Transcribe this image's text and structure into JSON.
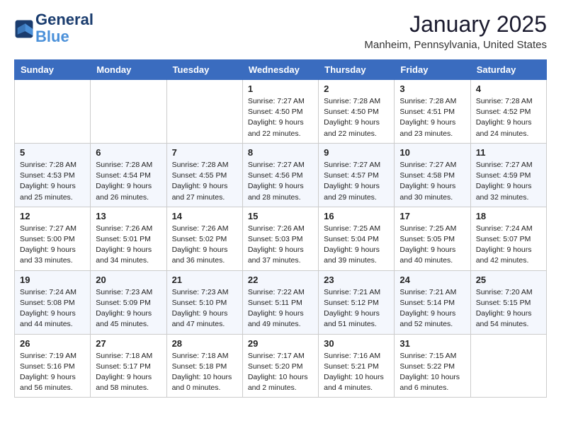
{
  "logo": {
    "line1": "General",
    "line2": "Blue"
  },
  "header": {
    "month": "January 2025",
    "location": "Manheim, Pennsylvania, United States"
  },
  "weekdays": [
    "Sunday",
    "Monday",
    "Tuesday",
    "Wednesday",
    "Thursday",
    "Friday",
    "Saturday"
  ],
  "weeks": [
    [
      {
        "day": "",
        "sunrise": "",
        "sunset": "",
        "daylight": ""
      },
      {
        "day": "",
        "sunrise": "",
        "sunset": "",
        "daylight": ""
      },
      {
        "day": "",
        "sunrise": "",
        "sunset": "",
        "daylight": ""
      },
      {
        "day": "1",
        "sunrise": "Sunrise: 7:27 AM",
        "sunset": "Sunset: 4:50 PM",
        "daylight": "Daylight: 9 hours and 22 minutes."
      },
      {
        "day": "2",
        "sunrise": "Sunrise: 7:28 AM",
        "sunset": "Sunset: 4:50 PM",
        "daylight": "Daylight: 9 hours and 22 minutes."
      },
      {
        "day": "3",
        "sunrise": "Sunrise: 7:28 AM",
        "sunset": "Sunset: 4:51 PM",
        "daylight": "Daylight: 9 hours and 23 minutes."
      },
      {
        "day": "4",
        "sunrise": "Sunrise: 7:28 AM",
        "sunset": "Sunset: 4:52 PM",
        "daylight": "Daylight: 9 hours and 24 minutes."
      }
    ],
    [
      {
        "day": "5",
        "sunrise": "Sunrise: 7:28 AM",
        "sunset": "Sunset: 4:53 PM",
        "daylight": "Daylight: 9 hours and 25 minutes."
      },
      {
        "day": "6",
        "sunrise": "Sunrise: 7:28 AM",
        "sunset": "Sunset: 4:54 PM",
        "daylight": "Daylight: 9 hours and 26 minutes."
      },
      {
        "day": "7",
        "sunrise": "Sunrise: 7:28 AM",
        "sunset": "Sunset: 4:55 PM",
        "daylight": "Daylight: 9 hours and 27 minutes."
      },
      {
        "day": "8",
        "sunrise": "Sunrise: 7:27 AM",
        "sunset": "Sunset: 4:56 PM",
        "daylight": "Daylight: 9 hours and 28 minutes."
      },
      {
        "day": "9",
        "sunrise": "Sunrise: 7:27 AM",
        "sunset": "Sunset: 4:57 PM",
        "daylight": "Daylight: 9 hours and 29 minutes."
      },
      {
        "day": "10",
        "sunrise": "Sunrise: 7:27 AM",
        "sunset": "Sunset: 4:58 PM",
        "daylight": "Daylight: 9 hours and 30 minutes."
      },
      {
        "day": "11",
        "sunrise": "Sunrise: 7:27 AM",
        "sunset": "Sunset: 4:59 PM",
        "daylight": "Daylight: 9 hours and 32 minutes."
      }
    ],
    [
      {
        "day": "12",
        "sunrise": "Sunrise: 7:27 AM",
        "sunset": "Sunset: 5:00 PM",
        "daylight": "Daylight: 9 hours and 33 minutes."
      },
      {
        "day": "13",
        "sunrise": "Sunrise: 7:26 AM",
        "sunset": "Sunset: 5:01 PM",
        "daylight": "Daylight: 9 hours and 34 minutes."
      },
      {
        "day": "14",
        "sunrise": "Sunrise: 7:26 AM",
        "sunset": "Sunset: 5:02 PM",
        "daylight": "Daylight: 9 hours and 36 minutes."
      },
      {
        "day": "15",
        "sunrise": "Sunrise: 7:26 AM",
        "sunset": "Sunset: 5:03 PM",
        "daylight": "Daylight: 9 hours and 37 minutes."
      },
      {
        "day": "16",
        "sunrise": "Sunrise: 7:25 AM",
        "sunset": "Sunset: 5:04 PM",
        "daylight": "Daylight: 9 hours and 39 minutes."
      },
      {
        "day": "17",
        "sunrise": "Sunrise: 7:25 AM",
        "sunset": "Sunset: 5:05 PM",
        "daylight": "Daylight: 9 hours and 40 minutes."
      },
      {
        "day": "18",
        "sunrise": "Sunrise: 7:24 AM",
        "sunset": "Sunset: 5:07 PM",
        "daylight": "Daylight: 9 hours and 42 minutes."
      }
    ],
    [
      {
        "day": "19",
        "sunrise": "Sunrise: 7:24 AM",
        "sunset": "Sunset: 5:08 PM",
        "daylight": "Daylight: 9 hours and 44 minutes."
      },
      {
        "day": "20",
        "sunrise": "Sunrise: 7:23 AM",
        "sunset": "Sunset: 5:09 PM",
        "daylight": "Daylight: 9 hours and 45 minutes."
      },
      {
        "day": "21",
        "sunrise": "Sunrise: 7:23 AM",
        "sunset": "Sunset: 5:10 PM",
        "daylight": "Daylight: 9 hours and 47 minutes."
      },
      {
        "day": "22",
        "sunrise": "Sunrise: 7:22 AM",
        "sunset": "Sunset: 5:11 PM",
        "daylight": "Daylight: 9 hours and 49 minutes."
      },
      {
        "day": "23",
        "sunrise": "Sunrise: 7:21 AM",
        "sunset": "Sunset: 5:12 PM",
        "daylight": "Daylight: 9 hours and 51 minutes."
      },
      {
        "day": "24",
        "sunrise": "Sunrise: 7:21 AM",
        "sunset": "Sunset: 5:14 PM",
        "daylight": "Daylight: 9 hours and 52 minutes."
      },
      {
        "day": "25",
        "sunrise": "Sunrise: 7:20 AM",
        "sunset": "Sunset: 5:15 PM",
        "daylight": "Daylight: 9 hours and 54 minutes."
      }
    ],
    [
      {
        "day": "26",
        "sunrise": "Sunrise: 7:19 AM",
        "sunset": "Sunset: 5:16 PM",
        "daylight": "Daylight: 9 hours and 56 minutes."
      },
      {
        "day": "27",
        "sunrise": "Sunrise: 7:18 AM",
        "sunset": "Sunset: 5:17 PM",
        "daylight": "Daylight: 9 hours and 58 minutes."
      },
      {
        "day": "28",
        "sunrise": "Sunrise: 7:18 AM",
        "sunset": "Sunset: 5:18 PM",
        "daylight": "Daylight: 10 hours and 0 minutes."
      },
      {
        "day": "29",
        "sunrise": "Sunrise: 7:17 AM",
        "sunset": "Sunset: 5:20 PM",
        "daylight": "Daylight: 10 hours and 2 minutes."
      },
      {
        "day": "30",
        "sunrise": "Sunrise: 7:16 AM",
        "sunset": "Sunset: 5:21 PM",
        "daylight": "Daylight: 10 hours and 4 minutes."
      },
      {
        "day": "31",
        "sunrise": "Sunrise: 7:15 AM",
        "sunset": "Sunset: 5:22 PM",
        "daylight": "Daylight: 10 hours and 6 minutes."
      },
      {
        "day": "",
        "sunrise": "",
        "sunset": "",
        "daylight": ""
      }
    ]
  ]
}
